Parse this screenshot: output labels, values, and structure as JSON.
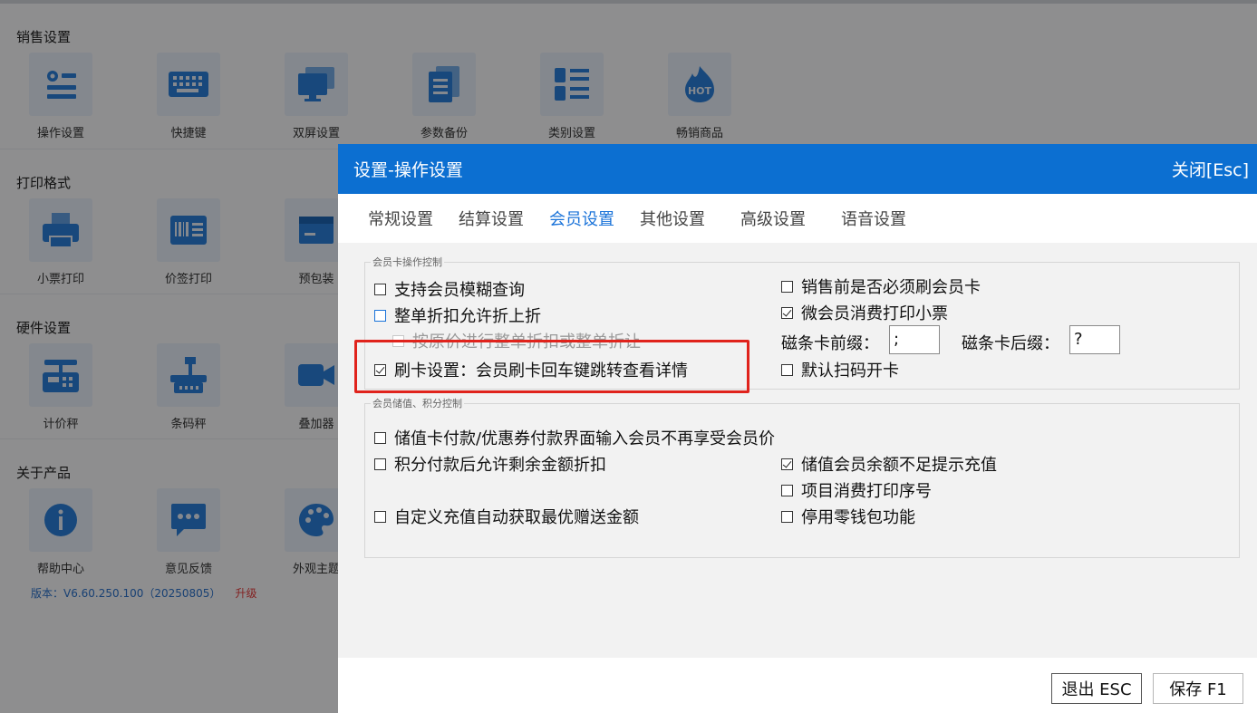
{
  "background": {
    "sections": [
      {
        "title": "销售设置",
        "tiles": [
          {
            "label": "操作设置",
            "icon": "settings-list-icon"
          },
          {
            "label": "快捷键",
            "icon": "keyboard-icon"
          },
          {
            "label": "双屏设置",
            "icon": "dual-monitor-icon"
          },
          {
            "label": "参数备份",
            "icon": "document-copy-icon"
          },
          {
            "label": "类别设置",
            "icon": "category-list-icon"
          },
          {
            "label": "畅销商品",
            "icon": "hot-flame-icon"
          }
        ]
      },
      {
        "title": "打印格式",
        "tiles": [
          {
            "label": "小票打印",
            "icon": "receipt-printer-icon"
          },
          {
            "label": "价签打印",
            "icon": "price-tag-icon"
          },
          {
            "label": "预包装",
            "icon": "package-icon"
          }
        ]
      },
      {
        "title": "硬件设置",
        "tiles": [
          {
            "label": "计价秤",
            "icon": "pricing-scale-icon"
          },
          {
            "label": "条码秤",
            "icon": "barcode-scale-icon"
          },
          {
            "label": "叠加器",
            "icon": "video-overlay-icon"
          }
        ]
      },
      {
        "title": "关于产品",
        "tiles": [
          {
            "label": "帮助中心",
            "icon": "info-icon"
          },
          {
            "label": "意见反馈",
            "icon": "chat-bubble-icon"
          },
          {
            "label": "外观主题",
            "icon": "palette-icon"
          }
        ]
      }
    ],
    "version": "版本：V6.60.250.100（20250805）",
    "upgrade": "升级",
    "hot_badge": "HOT"
  },
  "dialog": {
    "title": "设置-操作设置",
    "close": "关闭[Esc]",
    "tabs": [
      {
        "label": "常规设置",
        "active": false
      },
      {
        "label": "结算设置",
        "active": false
      },
      {
        "label": "会员设置",
        "active": true
      },
      {
        "label": "其他设置",
        "active": false
      },
      {
        "label": "高级设置",
        "active": false
      },
      {
        "label": "语音设置",
        "active": false
      }
    ],
    "group1": {
      "legend": "会员卡操作控制",
      "left_options": [
        {
          "label": "支持会员模糊查询",
          "checked": false
        },
        {
          "label": "整单折扣允许折上折",
          "checked": false
        },
        {
          "label": "按原价进行整单折扣或整单折让",
          "checked": false
        },
        {
          "label": "刷卡设置：会员刷卡回车键跳转查看详情",
          "checked": true
        }
      ],
      "right_options": [
        {
          "label": "销售前是否必须刷会员卡",
          "checked": false
        },
        {
          "label": "微会员消费打印小票",
          "checked": true
        },
        {
          "label": "默认扫码开卡",
          "checked": false
        }
      ],
      "prefix_label": "磁条卡前缀：",
      "prefix_value": ";",
      "suffix_label": "磁条卡后缀：",
      "suffix_value": "?"
    },
    "group2": {
      "legend": "会员储值、积分控制",
      "left_options": [
        {
          "label": "储值卡付款/优惠券付款界面输入会员不再享受会员价",
          "checked": false
        },
        {
          "label": "积分付款后允许剩余金额折扣",
          "checked": false
        },
        {
          "label": "自定义充值自动获取最优赠送金额",
          "checked": false
        }
      ],
      "right_options": [
        {
          "label": "储值会员余额不足提示充值",
          "checked": true
        },
        {
          "label": "项目消费打印序号",
          "checked": false
        },
        {
          "label": "停用零钱包功能",
          "checked": false
        }
      ]
    },
    "buttons": {
      "exit": "退出 ESC",
      "save": "保存 F1"
    },
    "colors": {
      "header": "#0c6fd1",
      "active_tab": "#1a73d9",
      "highlight": "#e0231c"
    }
  }
}
